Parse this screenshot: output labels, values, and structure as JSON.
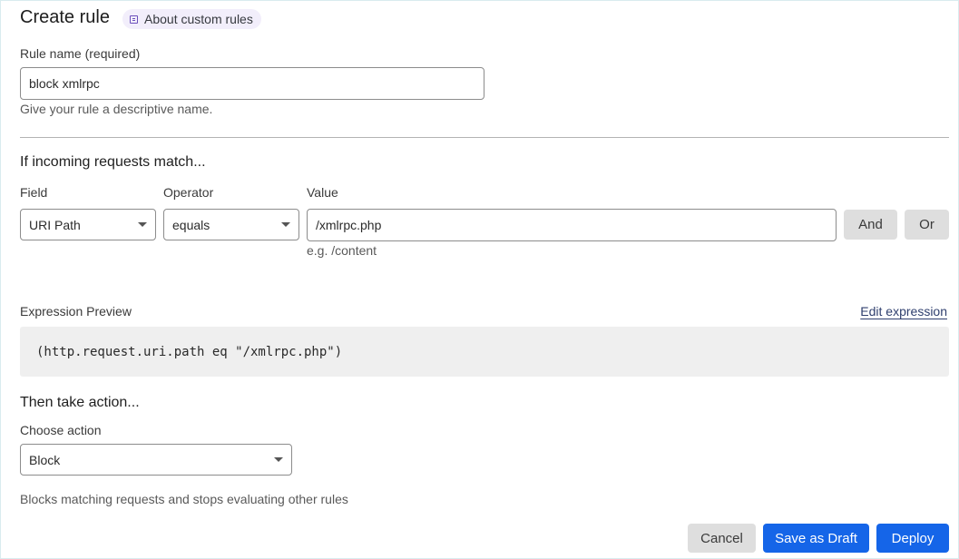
{
  "header": {
    "title": "Create rule",
    "about_link": {
      "label": "About custom rules",
      "icon": "book-icon"
    }
  },
  "rule_name": {
    "label": "Rule name (required)",
    "value": "block xmlrpc",
    "hint": "Give your rule a descriptive name."
  },
  "match": {
    "section_title": "If incoming requests match...",
    "field": {
      "label": "Field",
      "value": "URI Path"
    },
    "operator": {
      "label": "Operator",
      "value": "equals"
    },
    "value": {
      "label": "Value",
      "value": "/xmlrpc.php",
      "hint": "e.g. /content"
    },
    "and_label": "And",
    "or_label": "Or"
  },
  "expression": {
    "label": "Expression Preview",
    "edit_label": "Edit expression",
    "text": "(http.request.uri.path eq \"/xmlrpc.php\")"
  },
  "action": {
    "section_title": "Then take action...",
    "label": "Choose action",
    "value": "Block",
    "description": "Blocks matching requests and stops evaluating other rules"
  },
  "footer": {
    "cancel_label": "Cancel",
    "draft_label": "Save as Draft",
    "deploy_label": "Deploy"
  },
  "colors": {
    "primary": "#1565e8",
    "secondary_button": "#dedede",
    "pill_background": "#f2eefb"
  }
}
